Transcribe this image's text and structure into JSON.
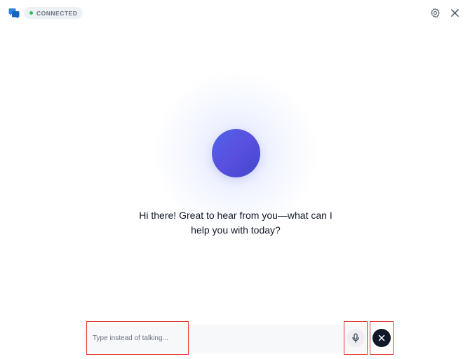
{
  "header": {
    "app_icon": "chat-bubbles-icon",
    "status_label": "CONNECTED",
    "status_color": "#22c55e",
    "settings_icon": "gear-icon",
    "close_icon": "close-icon"
  },
  "main": {
    "orb_colors": [
      "#4f64e6",
      "#3f47c9"
    ],
    "greeting_line1": "Hi there! Great to hear from you—what can I",
    "greeting_line2": "help you with today?"
  },
  "composer": {
    "placeholder": "Type instead of talking...",
    "value": "",
    "mic_icon": "microphone-icon",
    "end_icon": "close-icon",
    "end_button_color": "#111827"
  },
  "colors": {
    "accent": "#4f46e5",
    "highlight_outline": "#e53935"
  }
}
